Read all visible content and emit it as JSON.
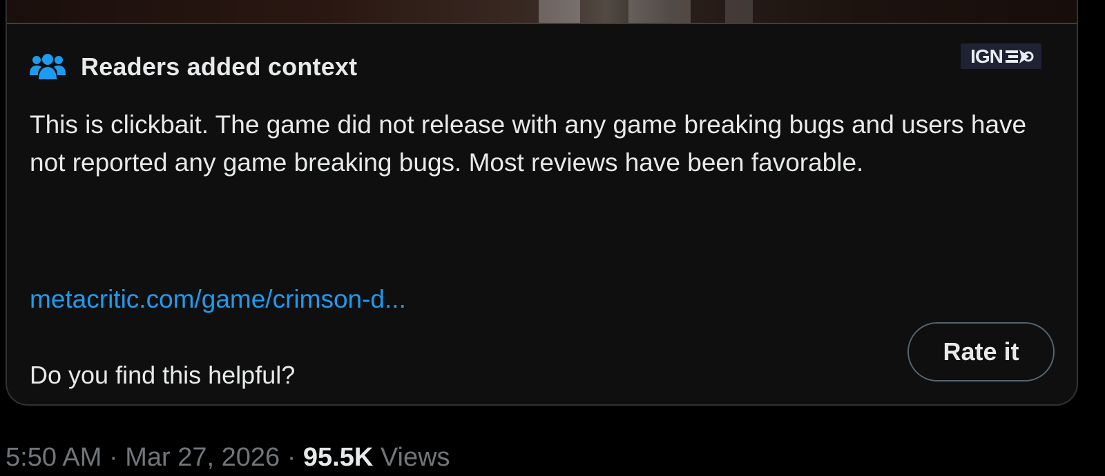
{
  "note": {
    "title": "Readers added context",
    "source_badge": "IGN",
    "body": "This is clickbait. The game did not release with any game breaking bugs and users have not reported any game breaking bugs. Most reviews have been favorable.",
    "link_text": "metacritic.com/game/crimson-d...",
    "helpful_question": "Do you find this helpful?",
    "rate_button_label": "Rate it",
    "icon": "people-icon",
    "accent_color": "#1d9bf0"
  },
  "post_meta": {
    "time": "5:50 AM",
    "separator": "·",
    "date": "Mar 27, 2026",
    "views_count": "95.5K",
    "views_label": "Views"
  },
  "colors": {
    "background": "#000000",
    "card_background": "#0f0f0f",
    "border": "#2f3336",
    "text_primary": "#e7e9ea",
    "text_secondary": "#71767b",
    "link": "#1d9bf0"
  }
}
